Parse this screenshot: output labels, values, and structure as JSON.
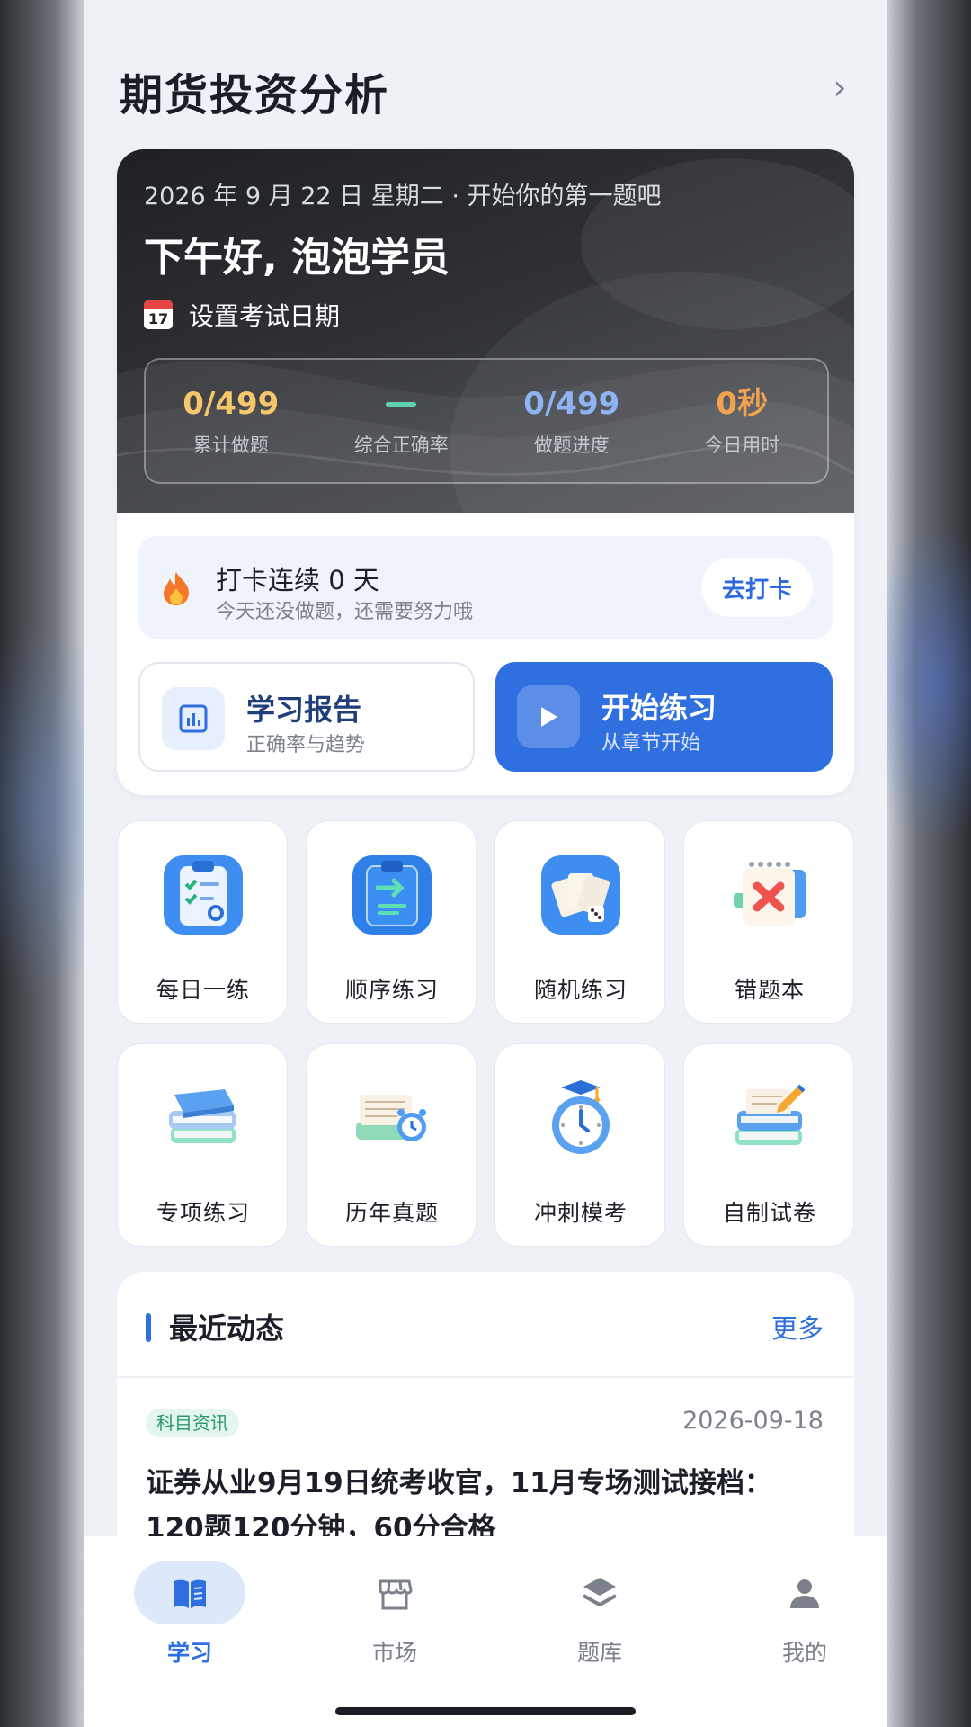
{
  "header": {
    "title": "期货投资分析"
  },
  "hero": {
    "date_line": "2026 年 9 月 22 日 星期二 · 开始你的第一题吧",
    "greeting": "下午好, 泡泡学员",
    "exam_label": "设置考试日期",
    "calendar_day": "17",
    "stats": [
      {
        "value": "0/499",
        "label": "累计做题",
        "color": "#f6c66b"
      },
      {
        "value": "",
        "label": "综合正确率",
        "color": "#5fd1b0"
      },
      {
        "value": "0/499",
        "label": "做题进度",
        "color": "#8fb4f5"
      },
      {
        "value": "0秒",
        "label": "今日用时",
        "color": "#f2a24f"
      }
    ]
  },
  "streak": {
    "title": "打卡连续 0 天",
    "subtitle": "今天还没做题，还需要努力哦",
    "button": "去打卡"
  },
  "actions": {
    "report": {
      "title": "学习报告",
      "subtitle": "正确率与趋势"
    },
    "start": {
      "title": "开始练习",
      "subtitle": "从章节开始"
    }
  },
  "tiles": [
    {
      "label": "每日一练",
      "icon": "clipboard-checklist-icon"
    },
    {
      "label": "顺序练习",
      "icon": "clipboard-arrow-icon"
    },
    {
      "label": "随机练习",
      "icon": "cards-dice-icon"
    },
    {
      "label": "错题本",
      "icon": "calendar-x-icon"
    },
    {
      "label": "专项练习",
      "icon": "book-stack-icon"
    },
    {
      "label": "历年真题",
      "icon": "papers-clock-icon"
    },
    {
      "label": "冲刺模考",
      "icon": "stopwatch-cap-icon"
    },
    {
      "label": "自制试卷",
      "icon": "books-pen-icon"
    }
  ],
  "feed": {
    "title": "最近动态",
    "more": "更多",
    "item": {
      "tag": "科目资讯",
      "date": "2026-09-18",
      "title": "证券从业9月19日统考收官，11月专场测试接档：120题120分钟，60分合格"
    }
  },
  "tabbar": [
    {
      "label": "学习",
      "icon": "book-open-icon",
      "active": true
    },
    {
      "label": "市场",
      "icon": "storefront-icon",
      "active": false
    },
    {
      "label": "题库",
      "icon": "layers-icon",
      "active": false
    },
    {
      "label": "我的",
      "icon": "person-icon",
      "active": false
    }
  ],
  "colors": {
    "accent": "#2f6fe0",
    "background": "#eef1f6"
  }
}
